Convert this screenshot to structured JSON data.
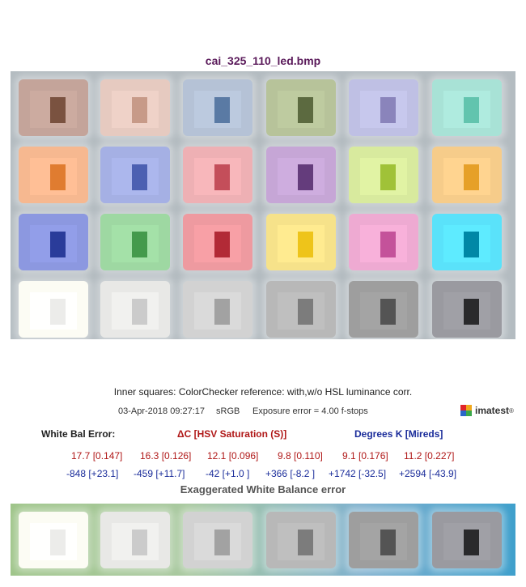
{
  "title": "cai_325_110_led.bmp",
  "chart_colors": [
    [
      [
        "#c4a49a",
        "#7a5240"
      ],
      [
        "#e6cac0",
        "#c79a88"
      ],
      [
        "#b5c2d6",
        "#5a7aa4"
      ],
      [
        "#b7c39a",
        "#5c6a40"
      ],
      [
        "#bfc0e4",
        "#8a84bb"
      ],
      [
        "#a8e2d6",
        "#62c4ae"
      ]
    ],
    [
      [
        "#f6b890",
        "#e07c30"
      ],
      [
        "#a5b0e4",
        "#4c60b2"
      ],
      [
        "#eeb0b4",
        "#c44e5a"
      ],
      [
        "#c6a6d6",
        "#643c7c"
      ],
      [
        "#d8ea9e",
        "#a0c238"
      ],
      [
        "#f6cc8a",
        "#e6a028"
      ]
    ],
    [
      [
        "#8c98e0",
        "#2a3c9a"
      ],
      [
        "#9ed8a2",
        "#449a4c"
      ],
      [
        "#ee9aa0",
        "#b22a36"
      ],
      [
        "#f6e28a",
        "#eec41a"
      ],
      [
        "#eeaad2",
        "#c4529a"
      ],
      [
        "#5ae2fa",
        "#0088a6"
      ]
    ],
    [
      [
        "#fcfcf4",
        "#ececea"
      ],
      [
        "#e8e8e6",
        "#cbcbcb"
      ],
      [
        "#d2d2d2",
        "#a2a2a2"
      ],
      [
        "#b8b8b8",
        "#7c7c7c"
      ],
      [
        "#9e9e9e",
        "#545454"
      ],
      [
        "#9a9aa0",
        "#2a2a2c"
      ]
    ]
  ],
  "bottom_colors": [
    [
      "#fcfcf4",
      "#ececea"
    ],
    [
      "#e8e8e6",
      "#cbcbcb"
    ],
    [
      "#d2d2d2",
      "#a2a2a2"
    ],
    [
      "#b8b8b8",
      "#7c7c7c"
    ],
    [
      "#9e9e9e",
      "#545454"
    ],
    [
      "#9a9aa0",
      "#2a2a2c"
    ]
  ],
  "caption": "Inner squares: ColorChecker reference: with,w/o HSL luminance corr.",
  "meta": {
    "date": "03-Apr-2018 09:27:17",
    "colorspace": "sRGB",
    "exposure": "Exposure error = 4.00 f-stops"
  },
  "logo": "imatest",
  "logo_reg": "®",
  "headers": {
    "wb": "White Bal Error:",
    "dc": "ΔC [HSV Saturation (S)]",
    "deg": "Degrees K [Mireds]"
  },
  "row1": [
    "17.7 [0.147]",
    "16.3 [0.126]",
    "12.1 [0.096]",
    "9.8 [0.110]",
    "9.1 [0.176]",
    "11.2 [0.227]"
  ],
  "row2": [
    "-848 [+23.1]",
    "-459 [+11.7]",
    "-42 [+1.0 ]",
    "+366 [-8.2 ]",
    "+1742 [-32.5]",
    "+2594 [-43.9]"
  ],
  "exaggerated": "Exaggerated White Balance error",
  "colors": {
    "title": "#5a1a5a",
    "red": "#b01818",
    "blue": "#1a2c9a"
  }
}
